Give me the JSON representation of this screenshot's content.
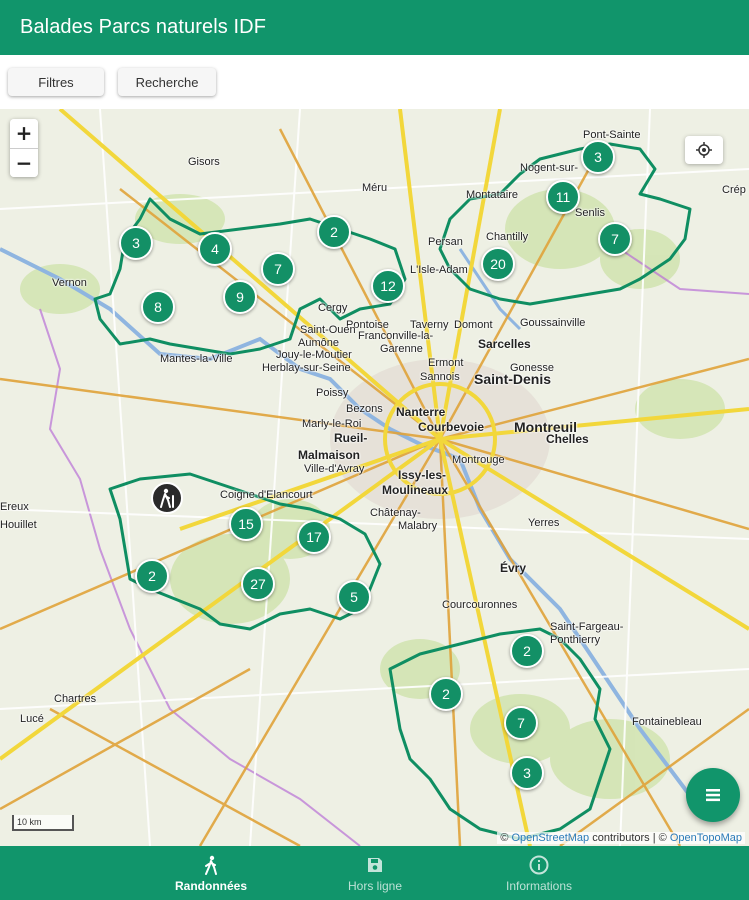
{
  "app": {
    "title": "Balades Parcs naturels IDF"
  },
  "toolbar": {
    "filters_label": "Filtres",
    "search_label": "Recherche"
  },
  "map": {
    "zoom_in": "+",
    "zoom_out": "−",
    "scale_label": "10 km",
    "attribution": {
      "prefix": "© ",
      "osm": "OpenStreetMap",
      "osm_suffix": " contributors | © ",
      "otm": "OpenTopoMap"
    },
    "place_labels": [
      {
        "name": "Pont-Sainte",
        "size": "normal"
      },
      {
        "name": "Gisors",
        "size": "normal"
      },
      {
        "name": "Méru",
        "size": "normal"
      },
      {
        "name": "Nogent-sur-",
        "size": "normal"
      },
      {
        "name": "Montataire",
        "size": "normal"
      },
      {
        "name": "Senlis",
        "size": "normal"
      },
      {
        "name": "Crép",
        "size": "normal"
      },
      {
        "name": "Chantilly",
        "size": "normal"
      },
      {
        "name": "Persan",
        "size": "normal"
      },
      {
        "name": "L'Isle-Adam",
        "size": "normal"
      },
      {
        "name": "Vernon",
        "size": "normal"
      },
      {
        "name": "Cergy",
        "size": "normal"
      },
      {
        "name": "Pontoise",
        "size": "normal"
      },
      {
        "name": "Saint-Ouen",
        "size": "normal"
      },
      {
        "name": "Taverny",
        "size": "normal"
      },
      {
        "name": "Domont",
        "size": "normal"
      },
      {
        "name": "Goussainville",
        "size": "normal"
      },
      {
        "name": "Franconville-la-",
        "size": "normal"
      },
      {
        "name": "Garenne",
        "size": "normal"
      },
      {
        "name": "Sarcelles",
        "size": "med"
      },
      {
        "name": "Gonesse",
        "size": "normal"
      },
      {
        "name": "Aumône",
        "size": "normal"
      },
      {
        "name": "Jouy-le-Moutier",
        "size": "normal"
      },
      {
        "name": "Herblay-sur-Seine",
        "size": "normal"
      },
      {
        "name": "Mantes-la-Ville",
        "size": "normal"
      },
      {
        "name": "Ermont",
        "size": "normal"
      },
      {
        "name": "Sannois",
        "size": "normal"
      },
      {
        "name": "Saint-Denis",
        "size": "big"
      },
      {
        "name": "Poissy",
        "size": "normal"
      },
      {
        "name": "Bezons",
        "size": "normal"
      },
      {
        "name": "Nanterre",
        "size": "med"
      },
      {
        "name": "Marly-le-Roi",
        "size": "normal"
      },
      {
        "name": "Courbevoie",
        "size": "med"
      },
      {
        "name": "Montreuil",
        "size": "big"
      },
      {
        "name": "Chelles",
        "size": "med"
      },
      {
        "name": "Rueil-",
        "size": "med"
      },
      {
        "name": "Malmaison",
        "size": "med"
      },
      {
        "name": "Montrouge",
        "size": "normal"
      },
      {
        "name": "Ville-d'Avray",
        "size": "normal"
      },
      {
        "name": "Issy-les-",
        "size": "med"
      },
      {
        "name": "Moulineaux",
        "size": "med"
      },
      {
        "name": "Coigne d'Elancourt",
        "size": "normal"
      },
      {
        "name": "Châtenay-",
        "size": "normal"
      },
      {
        "name": "Malabry",
        "size": "normal"
      },
      {
        "name": "Yerres",
        "size": "normal"
      },
      {
        "name": "Ereux",
        "size": "normal"
      },
      {
        "name": "Houillet",
        "size": "normal"
      },
      {
        "name": "Évry",
        "size": "med"
      },
      {
        "name": "Courcouronnes",
        "size": "normal"
      },
      {
        "name": "Saint-Fargeau-",
        "size": "normal"
      },
      {
        "name": "Ponthierry",
        "size": "normal"
      },
      {
        "name": "Chartres",
        "size": "normal"
      },
      {
        "name": "Lucé",
        "size": "normal"
      },
      {
        "name": "Fontainebleau",
        "size": "normal"
      }
    ],
    "clusters": [
      {
        "count": "3"
      },
      {
        "count": "11"
      },
      {
        "count": "7"
      },
      {
        "count": "3"
      },
      {
        "count": "4"
      },
      {
        "count": "2"
      },
      {
        "count": "7"
      },
      {
        "count": "20"
      },
      {
        "count": "9"
      },
      {
        "count": "12"
      },
      {
        "count": "8"
      },
      {
        "count": "15"
      },
      {
        "count": "17"
      },
      {
        "count": "2"
      },
      {
        "count": "27"
      },
      {
        "count": "5"
      },
      {
        "count": "2"
      },
      {
        "count": "2"
      },
      {
        "count": "7"
      },
      {
        "count": "3"
      }
    ]
  },
  "bottom_nav": [
    {
      "label": "Randonnées",
      "icon": "hiker-icon",
      "active": true
    },
    {
      "label": "Hors ligne",
      "icon": "save-icon",
      "active": false
    },
    {
      "label": "Informations",
      "icon": "info-icon",
      "active": false
    }
  ],
  "colors": {
    "primary": "#11956b",
    "cluster": "#139066",
    "park_boundary": "#0f8e62",
    "motorway": "#f2d73b",
    "main_road": "#e0a33a",
    "region_border": "#b86fd6",
    "seine": "#8fb5e0"
  }
}
